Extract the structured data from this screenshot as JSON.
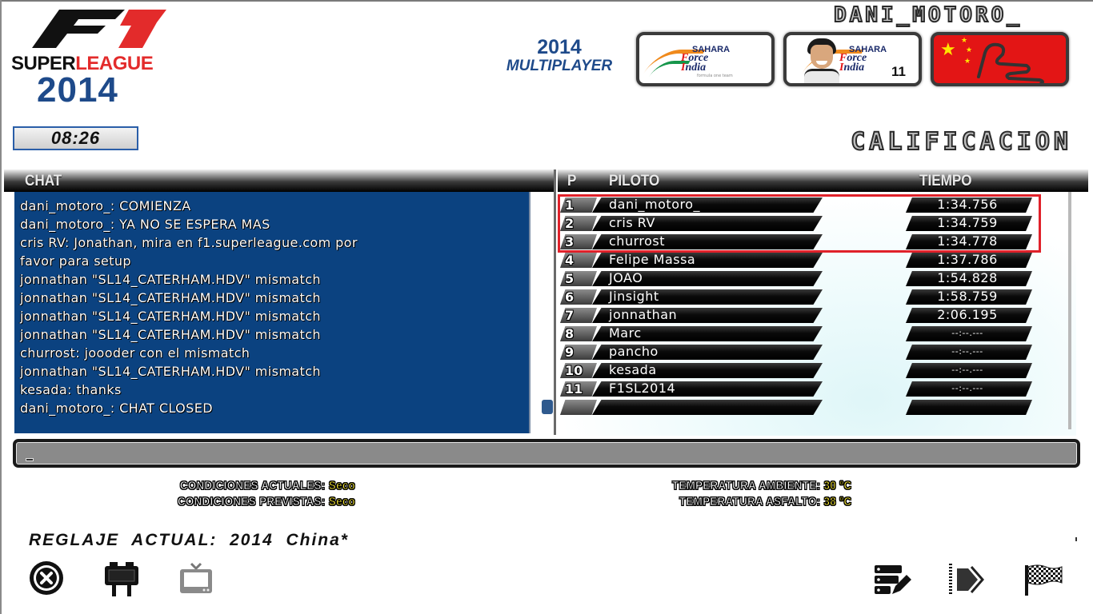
{
  "logo": {
    "f1": "F1",
    "super": "SUPER",
    "league": "LEAGUE",
    "year": "2014"
  },
  "clock": "08:26",
  "mode": {
    "year": "2014",
    "label": "MULTIPLAYER"
  },
  "player_name": "DANI_MOTORO_",
  "cards": {
    "team": {
      "sahara": "SAHARA",
      "force": "orce",
      "india": "ndia",
      "subtitle": "formula one team"
    },
    "driver": {
      "car_number": "11"
    },
    "track": {
      "country": "China"
    }
  },
  "session_title": "CALIFICACION",
  "chat": {
    "header": "CHAT",
    "messages": [
      "dani_motoro_: COMIENZA",
      "dani_motoro_: YA NO SE ESPERA MAS",
      "cris RV: Jonathan, mira en f1.superleague.com por",
      "favor para setup",
      "jonnathan \"SL14_CATERHAM.HDV\" mismatch",
      "jonnathan \"SL14_CATERHAM.HDV\" mismatch",
      "jonnathan \"SL14_CATERHAM.HDV\" mismatch",
      "jonnathan \"SL14_CATERHAM.HDV\" mismatch",
      "churrost: joooder con el mismatch",
      "jonnathan \"SL14_CATERHAM.HDV\" mismatch",
      "kesada: thanks",
      "dani_motoro_: CHAT CLOSED"
    ],
    "input_value": ""
  },
  "results": {
    "headers": {
      "pos": "P",
      "driver": "PILOTO",
      "time": "TIEMPO"
    },
    "rows": [
      {
        "pos": "1",
        "driver": "dani_motoro_",
        "time": "1:34.756"
      },
      {
        "pos": "2",
        "driver": "cris RV",
        "time": "1:34.759"
      },
      {
        "pos": "3",
        "driver": "churrost",
        "time": "1:34.778"
      },
      {
        "pos": "4",
        "driver": "Felipe Massa",
        "time": "1:37.786"
      },
      {
        "pos": "5",
        "driver": "JOAO",
        "time": "1:54.828"
      },
      {
        "pos": "6",
        "driver": "Jinsight",
        "time": "1:58.759"
      },
      {
        "pos": "7",
        "driver": "jonnathan",
        "time": "2:06.195"
      },
      {
        "pos": "8",
        "driver": "Marc",
        "time": "--:--.---"
      },
      {
        "pos": "9",
        "driver": "pancho",
        "time": "--:--.---"
      },
      {
        "pos": "10",
        "driver": "kesada",
        "time": "--:--.---"
      },
      {
        "pos": "11",
        "driver": "F1SL2014",
        "time": "--:--.---"
      },
      {
        "pos": "",
        "driver": "",
        "time": ""
      }
    ],
    "highlight_color": "#e0212a"
  },
  "conditions": {
    "current_label": "CONDICIONES ACTUALES:",
    "current_value": "Seco",
    "forecast_label": "CONDICIONES PREVISTAS:",
    "forecast_value": "Seco",
    "ambient_label": "TEMPERATURA AMBIENTE:",
    "ambient_value": "30 ºC",
    "track_label": "TEMPERATURA ASFALTO:",
    "track_value": "38 ºC"
  },
  "setup": {
    "label": "REGLAJE  ACTUAL:",
    "value": "2014  China*"
  },
  "icons": {
    "exit": "close-circle-icon",
    "garage": "garage-sign-icon",
    "tv": "tv-icon",
    "setup_edit": "setup-edit-icon",
    "drive": "drive-forward-icon",
    "race": "checkered-flag-icon"
  },
  "colors": {
    "chat_bg": "#0b4280",
    "brand_blue": "#1e4a8a",
    "brand_red": "#e32b2b",
    "condition_value": "#f6e733"
  }
}
